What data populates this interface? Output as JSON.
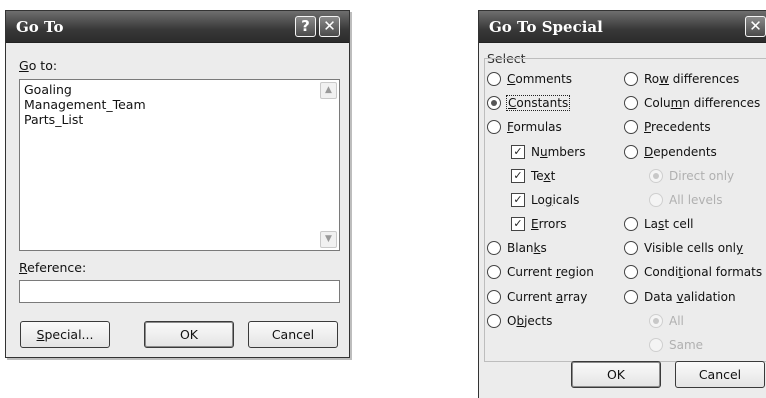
{
  "goto_dialog": {
    "title": "Go To",
    "help_button": "?",
    "close_button": "✕",
    "goto_label": "Go to:",
    "list_items": [
      "Goaling",
      "Management_Team",
      "Parts_List"
    ],
    "reference_label": "Reference:",
    "reference_value": "",
    "special_button": "Special...",
    "ok_button": "OK",
    "cancel_button": "Cancel"
  },
  "special_dialog": {
    "title": "Go To Special",
    "close_button": "✕",
    "group_label": "Select",
    "options": {
      "comments": "Comments",
      "constants": "Constants",
      "formulas": "Formulas",
      "numbers": "Numbers",
      "text": "Text",
      "logicals": "Logicals",
      "errors": "Errors",
      "blanks": "Blanks",
      "current_region": "Current region",
      "current_array": "Current array",
      "objects": "Objects",
      "row_differences": "Row differences",
      "column_differences": "Column differences",
      "precedents": "Precedents",
      "dependents": "Dependents",
      "direct_only": "Direct only",
      "all_levels": "All levels",
      "last_cell": "Last cell",
      "visible_cells_only": "Visible cells only",
      "conditional_formats": "Conditional formats",
      "data_validation": "Data validation",
      "all": "All",
      "same": "Same"
    },
    "selected_option": "Constants",
    "checked_items": [
      "Numbers",
      "Text",
      "Logicals",
      "Errors"
    ],
    "ok_button": "OK",
    "cancel_button": "Cancel"
  }
}
